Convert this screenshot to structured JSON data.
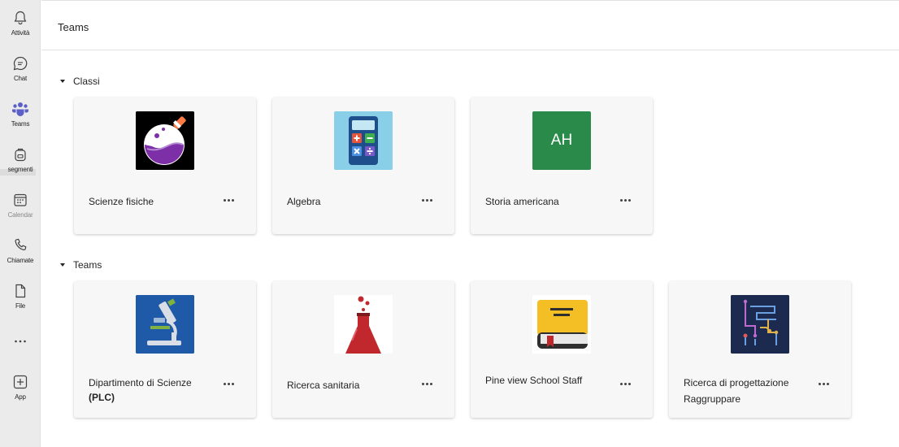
{
  "rail": {
    "items": [
      {
        "label": "Attività",
        "icon": "bell-icon"
      },
      {
        "label": "Chat",
        "icon": "chat-icon"
      },
      {
        "label": "Teams",
        "icon": "teams-icon"
      },
      {
        "label": "segmenti",
        "icon": "backpack-icon"
      },
      {
        "label": "Calendar",
        "icon": "calendar-icon"
      },
      {
        "label": "Chiamate",
        "icon": "phone-icon"
      },
      {
        "label": "File",
        "icon": "file-icon"
      },
      {
        "label": "App",
        "icon": "add-app-icon"
      }
    ],
    "more_icon": "ellipsis-icon",
    "active_color": "#5b5fc7"
  },
  "header": {
    "title": "Teams"
  },
  "sections": {
    "classi": {
      "title": "Classi",
      "cards": [
        {
          "name": "Scienze fisiche",
          "icon": "flask-purple-icon"
        },
        {
          "name": "Algebra",
          "icon": "calculator-icon"
        },
        {
          "name": "Storia americana",
          "initials": "AH",
          "color": "#2a8a4a"
        }
      ]
    },
    "teams": {
      "title": "Teams",
      "cards": [
        {
          "name": "Dipartimento di Scienze",
          "sub": "(PLC)",
          "icon": "microscope-icon"
        },
        {
          "name": "Ricerca sanitaria",
          "icon": "red-flask-icon"
        },
        {
          "name": "Pine view School Staff",
          "icon": "book-icon"
        },
        {
          "name": "Ricerca di progettazione",
          "sub": "Raggruppare",
          "icon": "circuit-icon"
        }
      ]
    }
  }
}
